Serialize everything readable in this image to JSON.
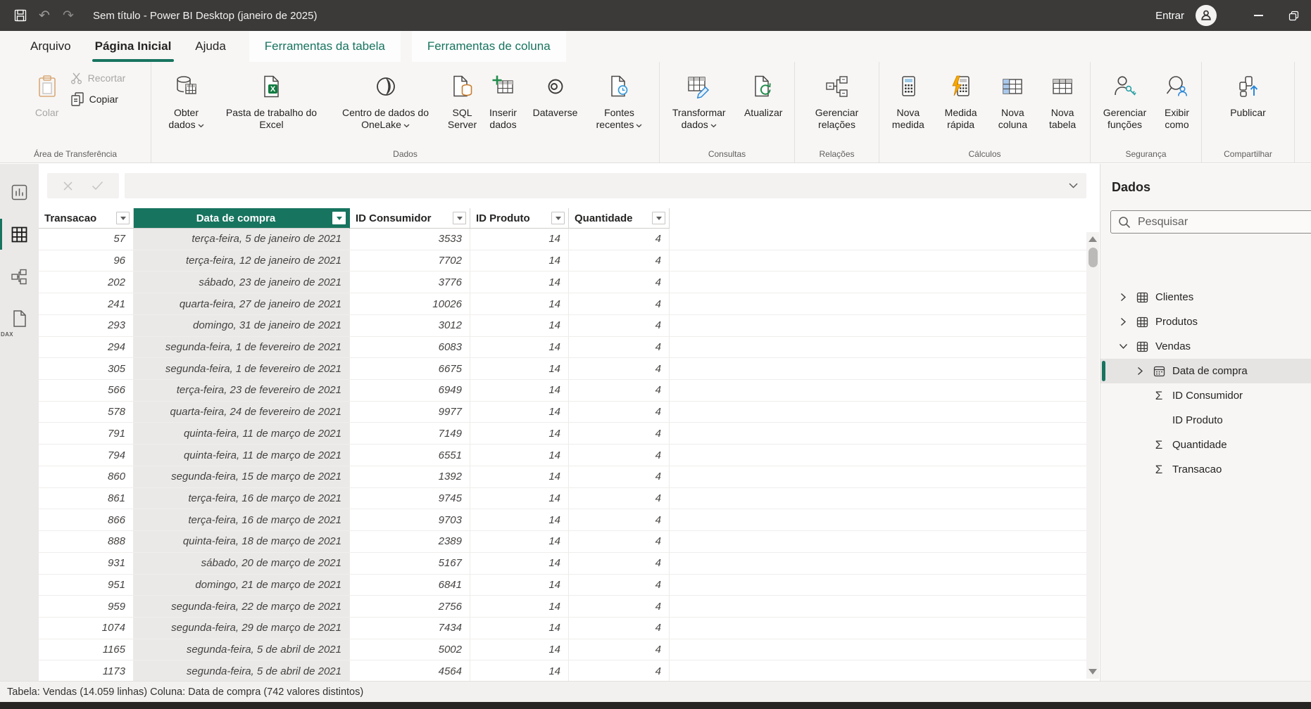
{
  "colors": {
    "accent": "#17745f",
    "titlebar_bg": "#3b3a39",
    "excel_green": "#107c41",
    "sql_orange": "#c77f2e",
    "pencil_blue": "#2b88d8",
    "refresh_green": "#218c4b",
    "lightning_yellow": "#f8a800",
    "clock_blue": "#3b9bd6",
    "key_teal": "#2aa0a4",
    "selected_column_bg": "#eae9e8"
  },
  "titlebar": {
    "title": "Sem título - Power BI Desktop (janeiro de 2025)",
    "sign_in": "Entrar"
  },
  "tabs": {
    "items": [
      {
        "label": "Arquivo",
        "selected": false,
        "contextual": false
      },
      {
        "label": "Página Inicial",
        "selected": true,
        "contextual": false
      },
      {
        "label": "Ajuda",
        "selected": false,
        "contextual": false
      },
      {
        "label": "Ferramentas da tabela",
        "selected": false,
        "contextual": true
      },
      {
        "label": "Ferramentas de coluna",
        "selected": false,
        "contextual": true
      }
    ]
  },
  "ribbon": {
    "clipboard": {
      "label": "Área de Transferência",
      "paste": "Colar",
      "cut": "Recortar",
      "copy": "Copiar"
    },
    "data": {
      "label": "Dados",
      "get_data": "Obter dados",
      "excel_workbook": "Pasta de trabalho do Excel",
      "onelake": "Centro de dados do OneLake",
      "sql_server": "SQL Server",
      "enter_data": "Inserir dados",
      "dataverse": "Dataverse",
      "recent_sources": "Fontes recentes"
    },
    "queries": {
      "label": "Consultas",
      "transform": "Transformar dados",
      "refresh": "Atualizar"
    },
    "relationships": {
      "label": "Relações",
      "manage": "Gerenciar relações"
    },
    "calculations": {
      "label": "Cálculos",
      "new_measure": "Nova medida",
      "quick_measure": "Medida rápida",
      "new_column": "Nova coluna",
      "new_table": "Nova tabela"
    },
    "security": {
      "label": "Segurança",
      "manage_roles": "Gerenciar funções",
      "view_as": "Exibir como"
    },
    "share": {
      "label": "Compartilhar",
      "publish": "Publicar"
    }
  },
  "sidebar": {
    "dax_label": "DAX"
  },
  "grid": {
    "columns": [
      "Transacao",
      "Data de compra",
      "ID Consumidor",
      "ID Produto",
      "Quantidade"
    ],
    "selected_column": "Data de compra",
    "rows": [
      [
        "57",
        "terça-feira, 5 de janeiro de 2021",
        "3533",
        "14",
        "4"
      ],
      [
        "96",
        "terça-feira, 12 de janeiro de 2021",
        "7702",
        "14",
        "4"
      ],
      [
        "202",
        "sábado, 23 de janeiro de 2021",
        "3776",
        "14",
        "4"
      ],
      [
        "241",
        "quarta-feira, 27 de janeiro de 2021",
        "10026",
        "14",
        "4"
      ],
      [
        "293",
        "domingo, 31 de janeiro de 2021",
        "3012",
        "14",
        "4"
      ],
      [
        "294",
        "segunda-feira, 1 de fevereiro de 2021",
        "6083",
        "14",
        "4"
      ],
      [
        "305",
        "segunda-feira, 1 de fevereiro de 2021",
        "6675",
        "14",
        "4"
      ],
      [
        "566",
        "terça-feira, 23 de fevereiro de 2021",
        "6949",
        "14",
        "4"
      ],
      [
        "578",
        "quarta-feira, 24 de fevereiro de 2021",
        "9977",
        "14",
        "4"
      ],
      [
        "791",
        "quinta-feira, 11 de março de 2021",
        "7149",
        "14",
        "4"
      ],
      [
        "794",
        "quinta-feira, 11 de março de 2021",
        "6551",
        "14",
        "4"
      ],
      [
        "860",
        "segunda-feira, 15 de março de 2021",
        "1392",
        "14",
        "4"
      ],
      [
        "861",
        "terça-feira, 16 de março de 2021",
        "9745",
        "14",
        "4"
      ],
      [
        "866",
        "terça-feira, 16 de março de 2021",
        "9703",
        "14",
        "4"
      ],
      [
        "888",
        "quinta-feira, 18 de março de 2021",
        "2389",
        "14",
        "4"
      ],
      [
        "931",
        "sábado, 20 de março de 2021",
        "5167",
        "14",
        "4"
      ],
      [
        "951",
        "domingo, 21 de março de 2021",
        "6841",
        "14",
        "4"
      ],
      [
        "959",
        "segunda-feira, 22 de março de 2021",
        "2756",
        "14",
        "4"
      ],
      [
        "1074",
        "segunda-feira, 29 de março de 2021",
        "7434",
        "14",
        "4"
      ],
      [
        "1165",
        "segunda-feira, 5 de abril de 2021",
        "5002",
        "14",
        "4"
      ],
      [
        "1173",
        "segunda-feira, 5 de abril de 2021",
        "4564",
        "14",
        "4"
      ]
    ]
  },
  "fields_pane": {
    "title": "Dados",
    "search_placeholder": "Pesquisar",
    "tree": [
      {
        "label": "Clientes",
        "level": 0,
        "chevron": "collapsed",
        "icon": "table",
        "selected": false
      },
      {
        "label": "Produtos",
        "level": 0,
        "chevron": "collapsed",
        "icon": "table",
        "selected": false
      },
      {
        "label": "Vendas",
        "level": 0,
        "chevron": "expanded",
        "icon": "table",
        "selected": false
      },
      {
        "label": "Data de compra",
        "level": 1,
        "chevron": "collapsed",
        "icon": "date-table",
        "selected": true
      },
      {
        "label": "ID Consumidor",
        "level": 1,
        "chevron": null,
        "icon": "sigma",
        "selected": false
      },
      {
        "label": "ID Produto",
        "level": 1,
        "chevron": null,
        "icon": null,
        "selected": false
      },
      {
        "label": "Quantidade",
        "level": 1,
        "chevron": null,
        "icon": "sigma",
        "selected": false
      },
      {
        "label": "Transacao",
        "level": 1,
        "chevron": null,
        "icon": "sigma",
        "selected": false
      }
    ]
  },
  "status_bar": {
    "text": "Tabela: Vendas (14.059 linhas) Coluna: Data de compra (742 valores distintos)"
  }
}
